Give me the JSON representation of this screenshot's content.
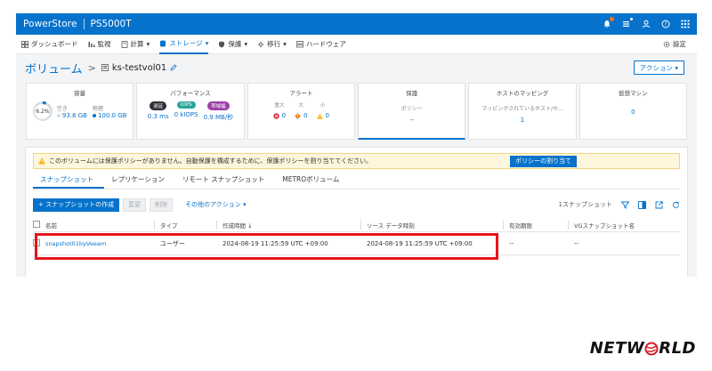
{
  "topbar": {
    "brand": "PowerStore",
    "system": "PS5000T",
    "icons": [
      "alert-bell-icon",
      "jobs-icon",
      "user-icon",
      "help-icon",
      "apps-grid-icon"
    ]
  },
  "nav": {
    "items": [
      {
        "label": "ダッシュボード",
        "icon": "dashboard-icon"
      },
      {
        "label": "監視",
        "icon": "monitor-icon"
      },
      {
        "label": "計算",
        "icon": "compute-icon",
        "dropdown": "▾"
      },
      {
        "label": "ストレージ",
        "icon": "storage-icon",
        "dropdown": "▾"
      },
      {
        "label": "保護",
        "icon": "protection-icon",
        "dropdown": "▾"
      },
      {
        "label": "移行",
        "icon": "migration-icon",
        "dropdown": "▾"
      },
      {
        "label": "ハードウェア",
        "icon": "hardware-icon"
      }
    ],
    "settings_label": "設定"
  },
  "breadcrumb": {
    "root": "ボリューム",
    "separator": ">",
    "volume": "ks-testvol01"
  },
  "actions_button": "アクション ▾",
  "cards": {
    "capacity": {
      "title": "容量",
      "percent": "6.2%",
      "percent_value": 6.2,
      "used_label": "空き",
      "used_value": "93.8 GB",
      "physical_label": "物理",
      "physical_value": "100.0 GB"
    },
    "performance": {
      "title": "パフォーマンス",
      "latency_label": "遅延",
      "latency_value": "0.3 ms",
      "iops_label": "IOPS",
      "iops_value": "0 kIOPS",
      "bandwidth_label": "帯域幅",
      "bandwidth_value": "0.9 MB/秒"
    },
    "alerts": {
      "title": "アラート",
      "critical_label": "重大",
      "critical_value": "0",
      "major_label": "大",
      "major_value": "0",
      "minor_label": "小",
      "minor_value": "0"
    },
    "protection": {
      "title": "保護",
      "sub": "ポリシー",
      "value": "--"
    },
    "host_mapping": {
      "title": "ホストのマッピング",
      "sub": "マッピングされているホスト/ホ...",
      "value": "1"
    },
    "vm": {
      "title": "仮想マシン",
      "value": "0"
    }
  },
  "warning": {
    "text": "このボリュームには保護ポリシーがありません。自動保護を構成するために、保護ポリシーを割り当ててください。",
    "button": "ポリシーの割り当て"
  },
  "tabs": [
    "スナップショット",
    "レプリケーション",
    "リモート スナップショット",
    "METROボリューム"
  ],
  "toolbar": {
    "create": "+ スナップショットの作成",
    "modify": "変更",
    "delete": "削除",
    "more": "その他のアクション ▾",
    "count": "1スナップショット"
  },
  "table": {
    "headers": {
      "name": "名前",
      "type": "タイプ",
      "created": "作成時間 ↓",
      "source": "ソース データ時刻",
      "expiry": "有効期限",
      "vg": "VGスナップショット名"
    },
    "rows": [
      {
        "name": "snapshot01byVeeam",
        "type": "ユーザー",
        "created": "2024-08-19 11:25:59 UTC +09:00",
        "source": "2024-08-19 11:25:59 UTC +09:00",
        "expiry": "--",
        "vg": "--"
      }
    ]
  },
  "footer_logo": {
    "prefix": "NETW",
    "suffix": "RLD"
  },
  "colors": {
    "accent": "#0672cb",
    "highlight": "#e8141b",
    "warning_bg": "#fdf6dc"
  }
}
